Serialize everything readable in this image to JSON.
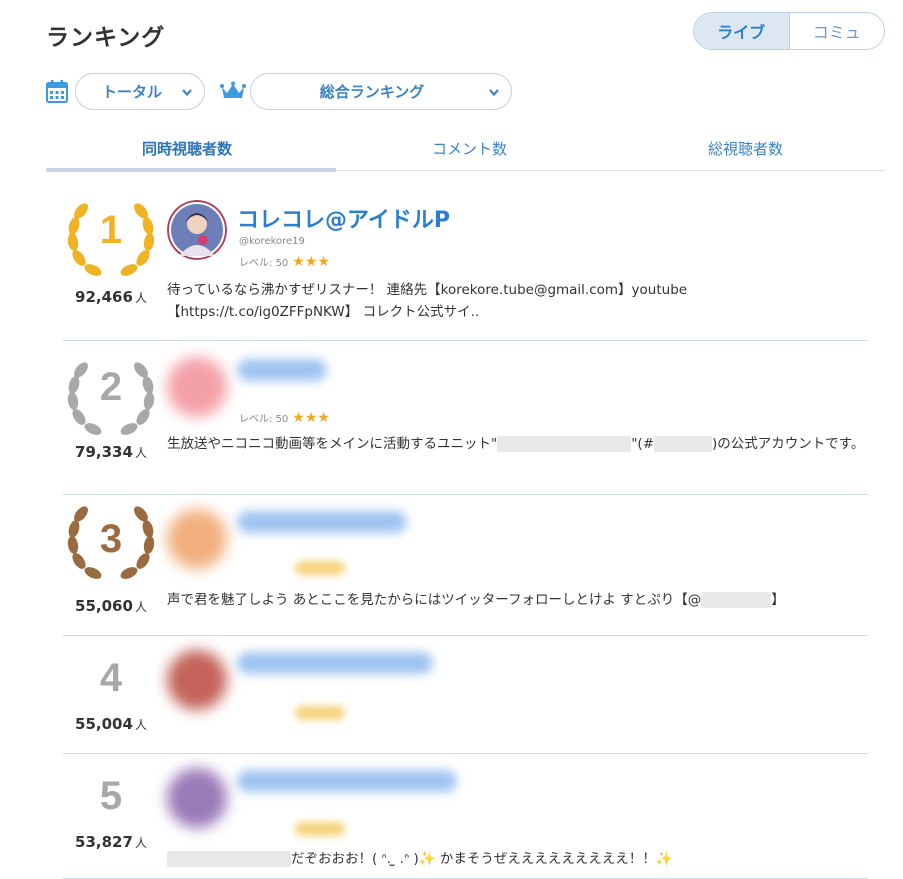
{
  "header": {
    "title": "ランキング",
    "toggle": {
      "live": "ライブ",
      "community": "コミュ"
    }
  },
  "filters": {
    "period": "トータル",
    "category": "総合ランキング"
  },
  "tabs": [
    "同時視聴者数",
    "コメント数",
    "総視聴者数"
  ],
  "count_unit": "人",
  "level_prefix": "レベル:",
  "colors": {
    "accent": "#2a7fd4",
    "gold": "#f0b323",
    "silver": "#a8a8a8",
    "bronze": "#9a6b40",
    "star": "#f2a91b"
  },
  "rankings": [
    {
      "rank": "1",
      "count": "92,466",
      "name": "コレコレ@アイドルP",
      "handle": "@korekore19",
      "level": "50",
      "stars": "★★★",
      "description": "待っているなら沸かすぜリスナー！ 連絡先【korekore.tube@gmail.com】youtube【https://t.co/ig0ZFFpNKW】 コレクト公式サイ.."
    },
    {
      "rank": "2",
      "count": "79,334",
      "level": "50",
      "stars": "★★★",
      "description_a": "生放送やニコニコ動画等をメインに活動するユニット\"",
      "description_b": "\"(#",
      "description_c": ")の公式アカウントです。"
    },
    {
      "rank": "3",
      "count": "55,060",
      "description": "声で君を魅了しよう あとここを見たからにはツイッターフォローしとけよ すとぷり【@",
      "description_end": "】"
    },
    {
      "rank": "4",
      "count": "55,004"
    },
    {
      "rank": "5",
      "count": "53,827",
      "description": "だぞおおお！( ᐢ. ̫ .ᐢ )",
      "description_b": "かまそうぜえええええええええ！！"
    }
  ]
}
